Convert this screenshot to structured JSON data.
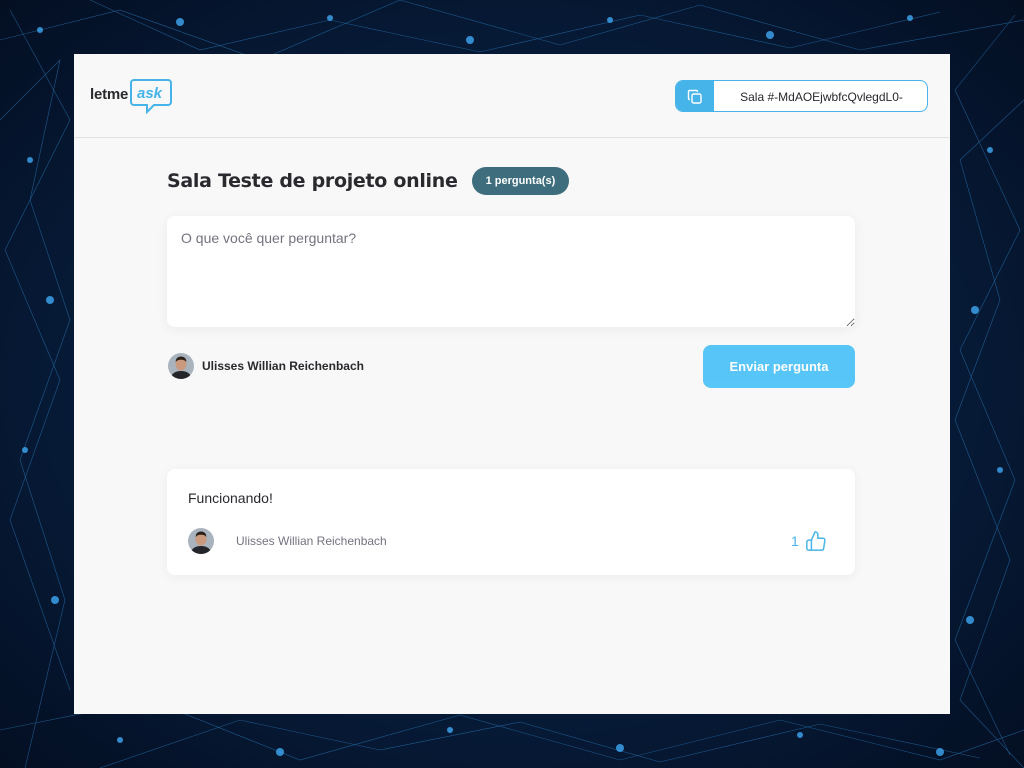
{
  "logo": {
    "text_primary": "letme",
    "text_accent": "ask"
  },
  "header": {
    "room_code_label": "Sala #-MdAOEjwbfcQvlegdL0-",
    "copy_icon": "copy-icon"
  },
  "room": {
    "title": "Sala Teste de projeto online",
    "question_count": "1 pergunta(s)"
  },
  "form": {
    "placeholder": "O que você quer perguntar?",
    "value": "",
    "user_name": "Ulisses Willian Reichenbach",
    "submit_label": "Enviar pergunta"
  },
  "questions": [
    {
      "content": "Funcionando!",
      "author": "Ulisses Willian Reichenbach",
      "like_count": "1",
      "like_icon": "thumbs-up-icon"
    }
  ],
  "colors": {
    "accent": "#46b4e8",
    "button": "#4fc3f7",
    "badge": "#3e6d7d",
    "text": "#29292e",
    "muted": "#737380",
    "background": "#f8f8f8"
  }
}
